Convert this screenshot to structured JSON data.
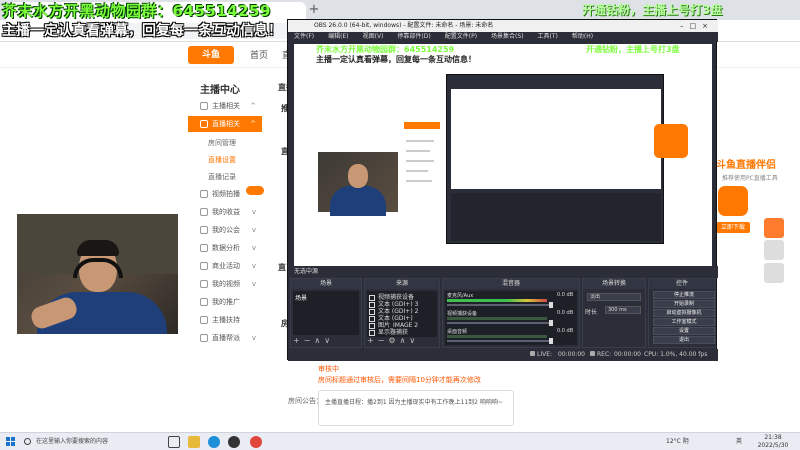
{
  "overlay": {
    "line1": "芥末水方开黑动物园群：645514259",
    "line2": "主播一定认真看弹幕，回复每一条互动信息！",
    "line3": "开通钻粉，主播上号打3盘"
  },
  "site": {
    "logo": "斗鱼",
    "nav_home": "首页",
    "nav_cut": "直",
    "sidebar_title": "主播中心",
    "items": [
      {
        "label": "主播相关"
      },
      {
        "label": "直播相关"
      },
      {
        "label": "房间管理"
      },
      {
        "label": "直播设置"
      },
      {
        "label": "直播记录"
      },
      {
        "label": "视频拍播"
      },
      {
        "label": "我的收益"
      },
      {
        "label": "我的公会"
      },
      {
        "label": "数据分析"
      },
      {
        "label": "商业活动"
      },
      {
        "label": "我的视频"
      },
      {
        "label": "我的推广"
      },
      {
        "label": "主播扶持"
      },
      {
        "label": "直播帮派"
      }
    ],
    "main_labels": [
      "直播",
      "推",
      "直",
      "直",
      "房"
    ],
    "orange_lines": [
      "审核中",
      "房间标题通过审核后，需要间隔10分钟才能再次修改"
    ],
    "notice_label": "房间公告：",
    "notice_text": "主播直播日程：播2到1 因为主播现实中有工作晚上11到2 响响响~",
    "promo_title": "斗鱼直播伴侣",
    "promo_sub": "推荐使用PC直播工具",
    "promo_btn": "立即下载"
  },
  "obs": {
    "title": "OBS 26.0.0 (64-bit, windows) - 配置文件: 未命名 - 场景: 未命名",
    "menu": [
      "文件(F)",
      "编辑(E)",
      "视图(V)",
      "停靠部件(D)",
      "配置文件(P)",
      "场景集合(S)",
      "工具(T)",
      "帮助(H)"
    ],
    "scene_bar": "无选中源",
    "dock_scenes": "场景",
    "dock_sources": "来源",
    "dock_mixer": "混音器",
    "dock_transitions": "场景转换",
    "dock_controls": "控件",
    "scene_item": "场景",
    "sources": [
      "视频捕获设备",
      "文本 (GDI+) 3",
      "文本 (GDI+) 2",
      "文本 (GDI+)",
      "图片_IMAGE 2",
      "显示器捕获"
    ],
    "mixer": [
      {
        "name": "麦克风/Aux",
        "db": "0.0 dB"
      },
      {
        "name": "视频捕获设备",
        "db": "0.0 dB"
      },
      {
        "name": "桌面音频",
        "db": "0.0 dB"
      }
    ],
    "transition_fade": "淡出",
    "transition_dur_label": "时长",
    "transition_dur": "300 ms",
    "controls": [
      "停止推流",
      "开始录制",
      "启动虚拟摄像机",
      "工作室模式",
      "设置",
      "退出"
    ],
    "status": {
      "live_label": "LIVE:",
      "live_time": "00:00:00",
      "rec_label": "REC:",
      "rec_time": "00:00:00",
      "cpu": "CPU: 1.0%, 40.00 fps"
    }
  },
  "taskbar": {
    "search_placeholder": "在这里输入你要搜索的内容",
    "weather": "12°C 阴",
    "lang": "英",
    "time": "21:38",
    "date": "2022/5/30"
  }
}
